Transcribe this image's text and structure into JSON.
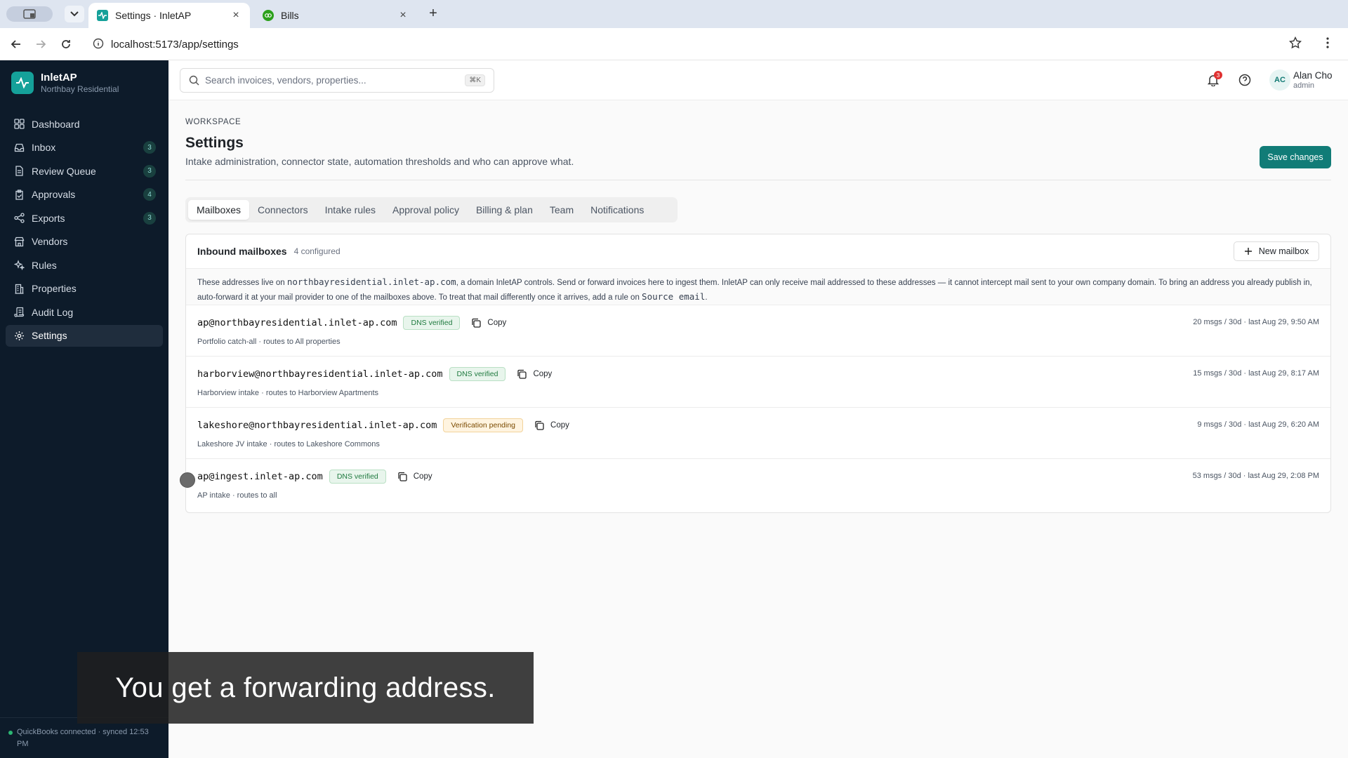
{
  "browser": {
    "tabs": [
      {
        "title": "Settings · InletAP"
      },
      {
        "title": "Bills"
      }
    ],
    "url": "localhost:5173/app/settings"
  },
  "sidebar": {
    "brand_name": "InletAP",
    "brand_sub": "Northbay Residential",
    "items": [
      {
        "label": "Dashboard",
        "icon": "grid-icon",
        "count": ""
      },
      {
        "label": "Inbox",
        "icon": "inbox-icon",
        "count": "3"
      },
      {
        "label": "Review Queue",
        "icon": "file-icon",
        "count": "3"
      },
      {
        "label": "Approvals",
        "icon": "clipboard-check-icon",
        "count": "4"
      },
      {
        "label": "Exports",
        "icon": "share-icon",
        "count": "3"
      },
      {
        "label": "Vendors",
        "icon": "store-icon",
        "count": ""
      },
      {
        "label": "Rules",
        "icon": "sparkles-icon",
        "count": ""
      },
      {
        "label": "Properties",
        "icon": "building-icon",
        "count": ""
      },
      {
        "label": "Audit Log",
        "icon": "scroll-icon",
        "count": ""
      },
      {
        "label": "Settings",
        "icon": "gear-icon",
        "count": ""
      }
    ],
    "active": "Settings",
    "footer": "QuickBooks connected · synced 12:53 PM"
  },
  "topbar": {
    "search_placeholder": "Search invoices, vendors, properties...",
    "shortcut": "⌘K",
    "notif_count": "3",
    "user_initials": "AC",
    "user_name": "Alan Cho",
    "user_role": "admin"
  },
  "page": {
    "eyebrow": "WORKSPACE",
    "title": "Settings",
    "subtitle": "Intake administration, connector state, automation thresholds and who can approve what.",
    "save_label": "Save changes",
    "tabs": [
      "Mailboxes",
      "Connectors",
      "Intake rules",
      "Approval policy",
      "Billing & plan",
      "Team",
      "Notifications"
    ],
    "active_tab": "Mailboxes"
  },
  "mailboxes": {
    "heading": "Inbound mailboxes",
    "count_label": "4 configured",
    "new_label": "New mailbox",
    "notice_a": "These addresses live on ",
    "notice_domain": "northbayresidential.inlet-ap.com",
    "notice_b": ", a domain InletAP controls. Send or forward invoices here to ingest them. InletAP can only receive mail addressed to these addresses — it cannot intercept mail sent to your own company domain. To bring an address you already publish in, auto-forward it at your mail provider to one of the mailboxes above. To treat that mail differently once it arrives, add a rule on ",
    "notice_field": "Source email",
    "notice_c": ".",
    "copy_label": "Copy",
    "rows": [
      {
        "address": "ap@northbayresidential.inlet-ap.com",
        "status": "DNS verified",
        "status_kind": "ok",
        "desc": "Portfolio catch-all · routes to All properties",
        "meta": "20 msgs / 30d · last Aug 29, 9:50 AM"
      },
      {
        "address": "harborview@northbayresidential.inlet-ap.com",
        "status": "DNS verified",
        "status_kind": "ok",
        "desc": "Harborview intake · routes to Harborview Apartments",
        "meta": "15 msgs / 30d · last Aug 29, 8:17 AM"
      },
      {
        "address": "lakeshore@northbayresidential.inlet-ap.com",
        "status": "Verification pending",
        "status_kind": "pend",
        "desc": "Lakeshore JV intake · routes to Lakeshore Commons",
        "meta": "9 msgs / 30d · last Aug 29, 6:20 AM"
      },
      {
        "address": "ap@ingest.inlet-ap.com",
        "status": "DNS verified",
        "status_kind": "ok",
        "desc": "AP intake · routes to all",
        "meta": "53 msgs / 30d · last Aug 29, 2:08 PM"
      }
    ]
  },
  "caption": "You get a forwarding address.",
  "colors": {
    "accent": "#117c77",
    "sidebar_bg": "#0d1b2a",
    "logo": "#15a19a"
  }
}
